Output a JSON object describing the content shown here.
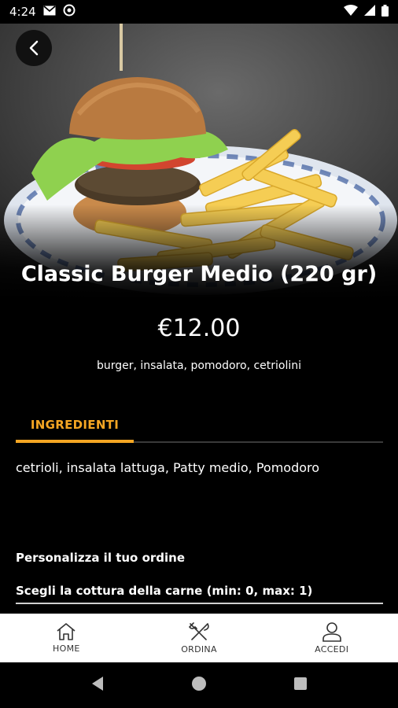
{
  "status_bar": {
    "time": "4:24"
  },
  "product": {
    "title": "Classic Burger Medio (220 gr)",
    "price": "€12.00",
    "description": "burger, insalata, pomodoro, cetriolini"
  },
  "tabs": [
    {
      "label": "INGREDIENTI",
      "active": true
    }
  ],
  "ingredients": "cetrioli, insalata lattuga, Patty medio, Pomodoro",
  "customization": {
    "heading": "Personalizza il tuo ordine",
    "option_label": "Scegli la cottura della carne  (min: 0, max: 1)"
  },
  "bottom_nav": [
    {
      "label": "HOME",
      "icon": "home-icon"
    },
    {
      "label": "ORDINA",
      "icon": "fork-knife-icon"
    },
    {
      "label": "ACCEDI",
      "icon": "user-icon"
    }
  ],
  "colors": {
    "accent": "#f5a623",
    "background": "#000000",
    "nav_background": "#ffffff"
  }
}
